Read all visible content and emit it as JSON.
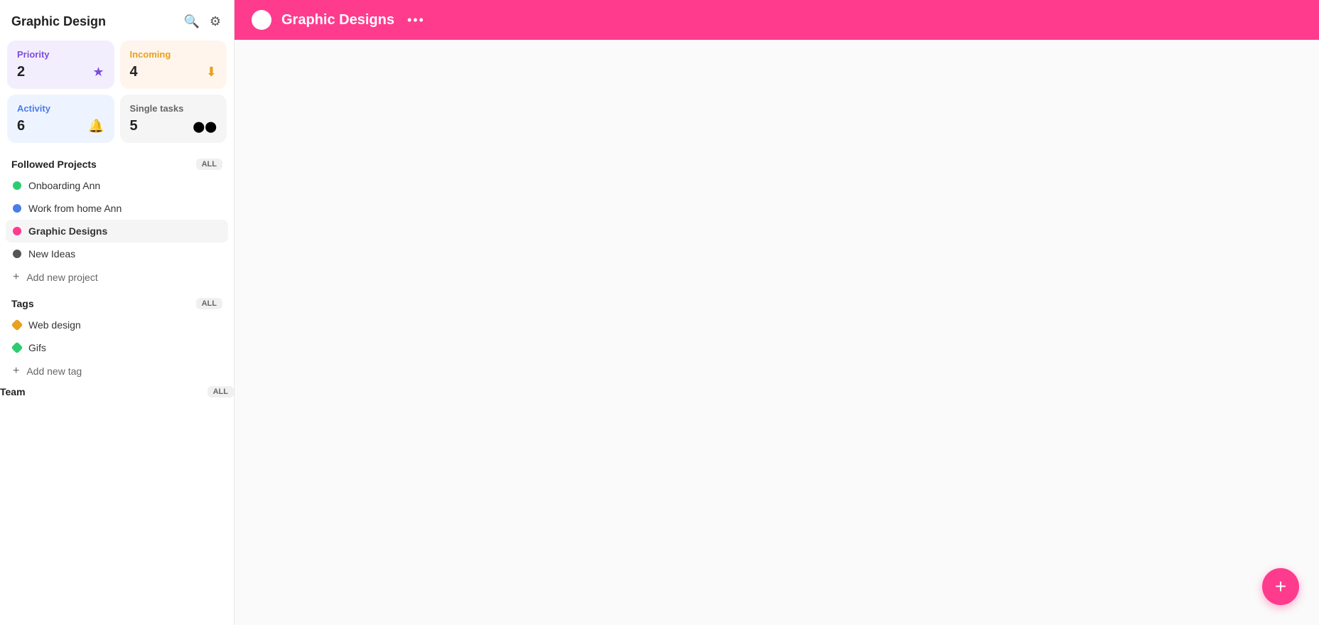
{
  "sidebar": {
    "title": "Graphic Design",
    "search_icon": "🔍",
    "settings_icon": "⚙",
    "stats": [
      {
        "id": "priority",
        "label": "Priority",
        "count": "2",
        "icon": "★",
        "theme": "purple"
      },
      {
        "id": "incoming",
        "label": "Incoming",
        "count": "4",
        "icon": "⬇",
        "theme": "orange"
      },
      {
        "id": "activity",
        "label": "Activity",
        "count": "6",
        "icon": "🔔",
        "theme": "blue"
      },
      {
        "id": "single-tasks",
        "label": "Single tasks",
        "count": "5",
        "icon": "●●",
        "theme": "gray"
      }
    ],
    "followed_projects": {
      "section_label": "Followed Projects",
      "all_label": "ALL",
      "items": [
        {
          "name": "Onboarding Ann",
          "color": "#2ecc71",
          "active": false
        },
        {
          "name": "Work from home Ann",
          "color": "#4a7de8",
          "active": false
        },
        {
          "name": "Graphic Designs",
          "color": "#ff3b8e",
          "active": true
        },
        {
          "name": "New Ideas",
          "color": "#555",
          "active": false
        }
      ],
      "add_label": "Add new project"
    },
    "tags": {
      "section_label": "Tags",
      "all_label": "ALL",
      "items": [
        {
          "name": "Web design",
          "color": "#e8a020"
        },
        {
          "name": "Gifs",
          "color": "#2ecc71"
        }
      ],
      "add_label": "Add new tag"
    },
    "team": {
      "section_label": "Team",
      "all_label": "ALL"
    }
  },
  "main": {
    "header": {
      "project_title": "Graphic Designs",
      "more_icon": "•••"
    }
  },
  "fab": {
    "label": "+"
  }
}
